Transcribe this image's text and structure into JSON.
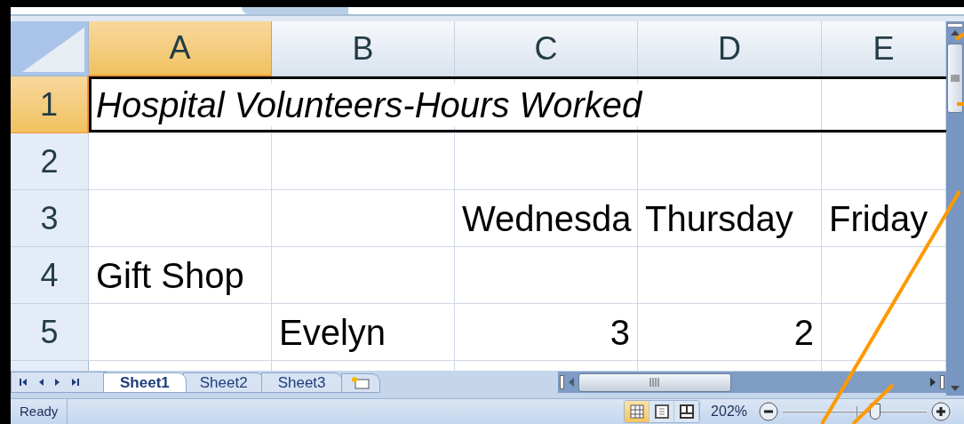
{
  "columns": [
    {
      "label": "A",
      "selected": true
    },
    {
      "label": "B",
      "selected": false
    },
    {
      "label": "C",
      "selected": false
    },
    {
      "label": "D",
      "selected": false
    },
    {
      "label": "E",
      "selected": false
    }
  ],
  "rows": [
    {
      "label": "1",
      "selected": true,
      "cells": {
        "A": {
          "text": "Hospital Volunteers-Hours Worked",
          "kind": "text",
          "italic": true,
          "selected": true
        }
      }
    },
    {
      "label": "2",
      "selected": false,
      "cells": {}
    },
    {
      "label": "3",
      "selected": false,
      "cells": {
        "C": {
          "text": "Wednesda",
          "kind": "text",
          "italic": false,
          "selected": false
        },
        "D": {
          "text": "Thursday",
          "kind": "text",
          "italic": false,
          "selected": false
        },
        "E": {
          "text": "Friday",
          "kind": "text",
          "italic": false,
          "selected": false
        }
      }
    },
    {
      "label": "4",
      "selected": false,
      "cells": {
        "A": {
          "text": "Gift Shop",
          "kind": "text",
          "italic": false,
          "selected": false
        }
      }
    },
    {
      "label": "5",
      "selected": false,
      "cells": {
        "B": {
          "text": "Evelyn",
          "kind": "text",
          "italic": false,
          "selected": false
        },
        "C": {
          "text": "3",
          "kind": "number",
          "italic": false,
          "selected": false
        },
        "D": {
          "text": "2",
          "kind": "number",
          "italic": false,
          "selected": false
        }
      }
    }
  ],
  "sheet_tabs": [
    {
      "label": "Sheet1",
      "selected": true
    },
    {
      "label": "Sheet2",
      "selected": false
    },
    {
      "label": "Sheet3",
      "selected": false
    }
  ],
  "status_bar": {
    "status": "Ready",
    "views": [
      {
        "kind": "normal",
        "selected": true
      },
      {
        "kind": "page_layout",
        "selected": false
      },
      {
        "kind": "page_break",
        "selected": false
      }
    ],
    "zoom": "202%",
    "zoom_slider": {
      "level": 0.64
    }
  }
}
